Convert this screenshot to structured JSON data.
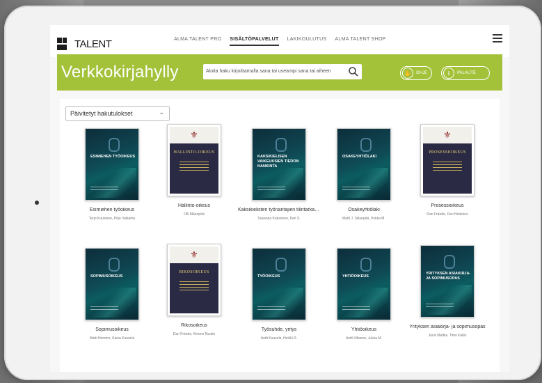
{
  "site": {
    "logo_text": "TALENT",
    "nav": [
      "ALMA TALENT PRO",
      "SISÄLTÖPALVELUT",
      "LAKIKOULUTUS",
      "ALMA TALENT SHOP"
    ],
    "active_nav": "SISÄLTÖPALVELUT"
  },
  "banner": {
    "title": "Verkkokirjahylly",
    "search_placeholder": "Aloita haku kirjoittamalla sana tai useampi sana tai aiheen",
    "btn_info": "OHJE",
    "btn_feedback": "PALAUTE",
    "accent": "#a3c23a"
  },
  "filter": {
    "selected": "Päivitetyt hakutulokset"
  },
  "books": [
    {
      "title": "Esimiehen työoikeus",
      "author": "Terjo Kuusinen, Pirjo Valkama",
      "cover": "teal",
      "cover_title": "ESIMIEHEN TYÖOIKEUS"
    },
    {
      "title": "Hallinto-oikeus",
      "author": "Olli Mäenpää",
      "cover": "classic",
      "cover_title": "HALLINTO-OIKEUS"
    },
    {
      "title": "Kaksikielisten työnantajien tilintarkastus",
      "author": "Susanna Kaksonen, Kari S.",
      "cover": "teal",
      "cover_title": "KAKSIKIELISEN VAIKEUKSIEN TIEDON HANKINTA"
    },
    {
      "title": "Osakeyhtiölaki",
      "author": "Matti J. Sillanpää, Pekka M.",
      "cover": "teal",
      "cover_title": "OSAKEYHTIÖLAKI"
    },
    {
      "title": "Prosessioikeus",
      "author": "Dan Frände, Dan Helenius",
      "cover": "classic",
      "cover_title": "PROSESSIOIKEUS"
    },
    {
      "title": "Sopimusoikeus",
      "author": "Matti Hemmo, Kaisa Kuusela",
      "cover": "teal",
      "cover_title": "SOPIMUSOIKEUS"
    },
    {
      "title": "Rikosoikeus",
      "author": "Dan Frände, Kimmo Nuotio",
      "cover": "classic",
      "cover_title": "RIKOSOIKEUS"
    },
    {
      "title": "Työsuhde, yritys",
      "author": "Antti Kuusela, Heikki R.",
      "cover": "teal",
      "cover_title": "TYÖOIKEUS"
    },
    {
      "title": "Yhtiöoikeus",
      "author": "Antti Villanen, Jukka M.",
      "cover": "teal",
      "cover_title": "YHTIÖOIKEUS"
    },
    {
      "title": "Yrityksen asiakirja- ja sopimusopas",
      "author": "Jussi Mattila, Timo Kallio",
      "cover": "teal",
      "cover_title": "YRITYKSEN ASIAKIRJA- JA SOPIMUSOPAS"
    }
  ]
}
